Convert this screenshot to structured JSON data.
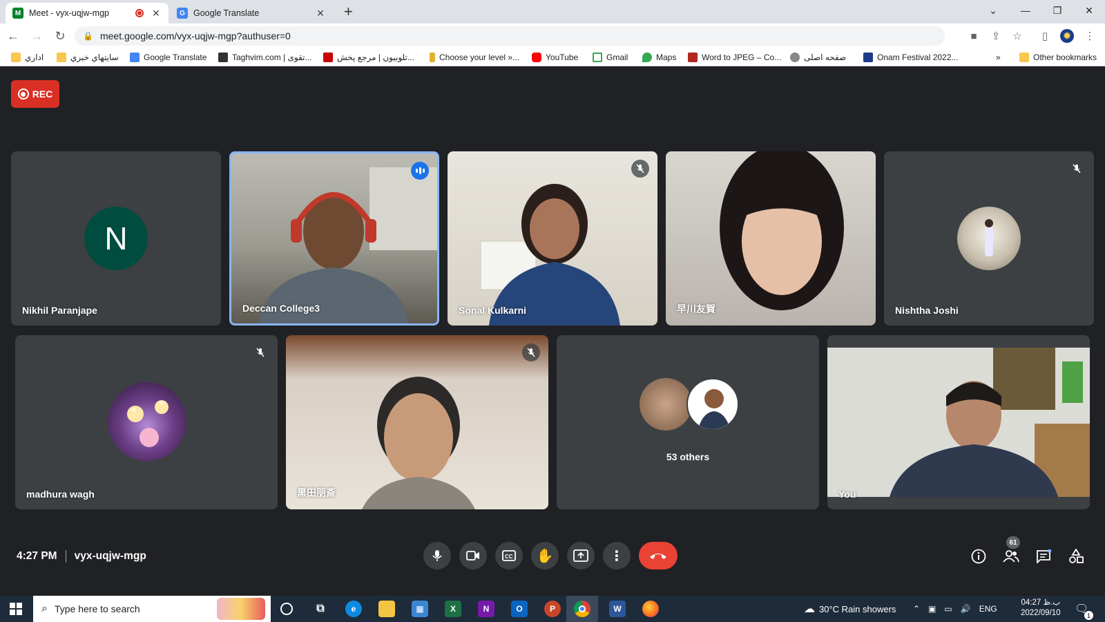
{
  "browser": {
    "tabs": [
      {
        "title": "Meet - vyx-uqjw-mgp",
        "active": true
      },
      {
        "title": "Google Translate",
        "active": false
      }
    ],
    "url": "meet.google.com/vyx-uqjw-mgp?authuser=0",
    "bookmarks": [
      "اداري",
      "سايتهاي خبري",
      "Google Translate",
      "Taghvim.com | تقوی...",
      "تلوبیون | مرجع پخش...",
      "Choose your level »...",
      "YouTube",
      "Gmail",
      "Maps",
      "Word to JPEG – Co...",
      "صفحه اصلی",
      "Onam Festival 2022...",
      "Other bookmarks"
    ],
    "bookmark_overflow": "»"
  },
  "meet": {
    "rec_label": "REC",
    "participants": [
      {
        "name": "Nikhil Paranjape",
        "initial": "N",
        "muted": false
      },
      {
        "name": "Deccan College3",
        "speaking": true
      },
      {
        "name": "Sonal Kulkarni",
        "muted": true
      },
      {
        "name": "早川友賀",
        "muted": false
      },
      {
        "name": "Nishtha Joshi",
        "muted": true
      },
      {
        "name": "madhura wagh",
        "muted": true
      },
      {
        "name": "黒田朋斎",
        "muted": true
      },
      {
        "name": "53 others"
      },
      {
        "name": "You"
      }
    ],
    "time": "4:27 PM",
    "meeting_code": "vyx-uqjw-mgp",
    "people_count": "61"
  },
  "taskbar": {
    "search_placeholder": "Type here to search",
    "weather": "30°C  Rain showers",
    "lang": "ENG",
    "clock_time": "04:27 ب.ظ",
    "clock_date": "2022/09/10",
    "notif_count": "1"
  },
  "colors": {
    "meet_bg": "#202124",
    "tile_bg": "#3c4043",
    "rec_red": "#d93025",
    "end_call_red": "#ea4335",
    "speaking_blue": "#8ab4f8"
  }
}
